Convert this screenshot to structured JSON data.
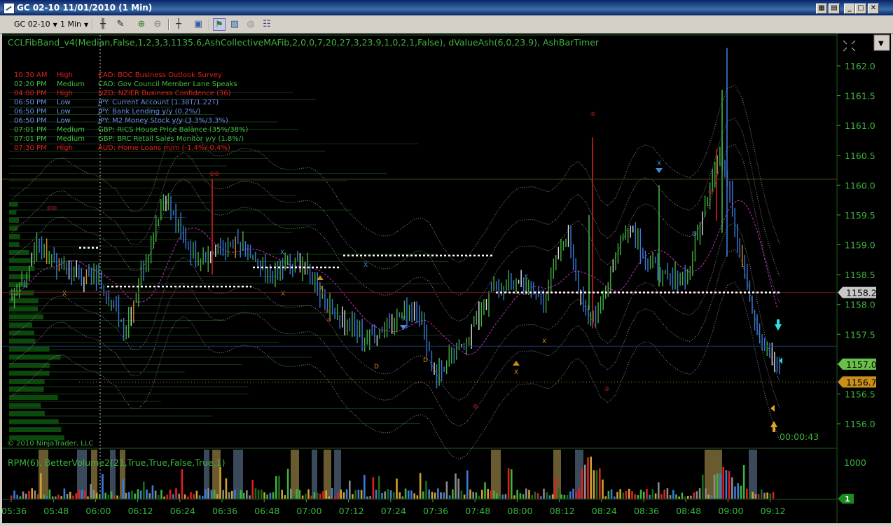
{
  "window": {
    "title": "GC 02-10  11/01/2010 (1 Min)"
  },
  "toolbar": {
    "instrument": "GC 02-10",
    "interval": "1 Min",
    "icons": [
      "bar-type-icon",
      "drawing-pencil-icon",
      "zoom-in-icon",
      "zoom-out-icon",
      "crosshair-icon",
      "properties-icon",
      "strategies-icon",
      "indicators-icon",
      "data-box-icon",
      "chart-trader-icon"
    ]
  },
  "chart": {
    "indicator_label": "CCLFibBand_v4(Median,False,1,2,3,3,1135.6,AshCollectiveMAFib,2,0,0,7,20,27,3,23.9,1,0,2,1,False), dValueAsh(6,0,23.9), AshBarTimer",
    "copyright": "© 2010 NinjaTrader, LLC",
    "timer": "00:00:43",
    "lower_label": "RPM(6), BetterVolume2(21,True,True,False,True,1)",
    "lower_axis_label": "1000",
    "lower_value_tag": "1",
    "price_ticks": [
      "1162.0",
      "1161.5",
      "1161.0",
      "1160.5",
      "1160.0",
      "1159.5",
      "1159.0",
      "1158.5",
      "1158.0",
      "1157.5",
      "1157.0",
      "1156.5",
      "1156.0"
    ],
    "price_tags": {
      "t1": {
        "label": "1158.2",
        "value": 1158.2,
        "color": "#c8c8c8"
      },
      "t2": {
        "label": "1157.0",
        "value": 1157.0,
        "color": "#6ac04a"
      },
      "t3": {
        "label": "1156.7",
        "value": 1156.7,
        "color": "#c8901a"
      }
    },
    "price_range": [
      1155.6,
      1162.4
    ],
    "time_ticks": [
      "05:36",
      "05:48",
      "06:00",
      "06:12",
      "06:24",
      "06:36",
      "06:48",
      "07:00",
      "07:12",
      "07:24",
      "07:36",
      "07:48",
      "08:00",
      "08:12",
      "08:24",
      "08:36",
      "08:48",
      "09:00",
      "09:12"
    ],
    "news": [
      {
        "time": "10:30 AM",
        "impact": "High",
        "event": "CAD: BOC Business Outlook Survey",
        "color": "#e02020"
      },
      {
        "time": "02:20 PM",
        "impact": "Medium",
        "event": "CAD: Gov Council Member Lane Speaks",
        "color": "#40c040"
      },
      {
        "time": "04:00 PM",
        "impact": "High",
        "event": "NZD: NZIER Business Confidence (36)",
        "color": "#e02020"
      },
      {
        "time": "06:50 PM",
        "impact": "Low",
        "event": "JPY: Current Account (1.38T/1.22T)",
        "color": "#6a8ee8"
      },
      {
        "time": "06:50 PM",
        "impact": "Low",
        "event": "JPY: Bank Lending y/y (0.2%/)",
        "color": "#6a8ee8"
      },
      {
        "time": "06:50 PM",
        "impact": "Low",
        "event": "JPY: M2 Money Stock y/y (3.3%/3.3%)",
        "color": "#6a8ee8"
      },
      {
        "time": "07:01 PM",
        "impact": "Medium",
        "event": "GBP: RICS House Price Balance (35%/38%)",
        "color": "#40c040"
      },
      {
        "time": "07:01 PM",
        "impact": "Medium",
        "event": "GBP: BRC Retail Sales Monitor y/y (1.8%/)",
        "color": "#40c040"
      },
      {
        "time": "07:30 PM",
        "impact": "High",
        "event": "AUD: Home Loans m/m (-1.4%/-0.4%)",
        "color": "#e02020"
      }
    ],
    "colors": {
      "up": "#40b040",
      "down": "#3a7ad8",
      "band": "#8a8a8a",
      "mid": "#c030c0",
      "text_green": "#3cb43c"
    }
  }
}
